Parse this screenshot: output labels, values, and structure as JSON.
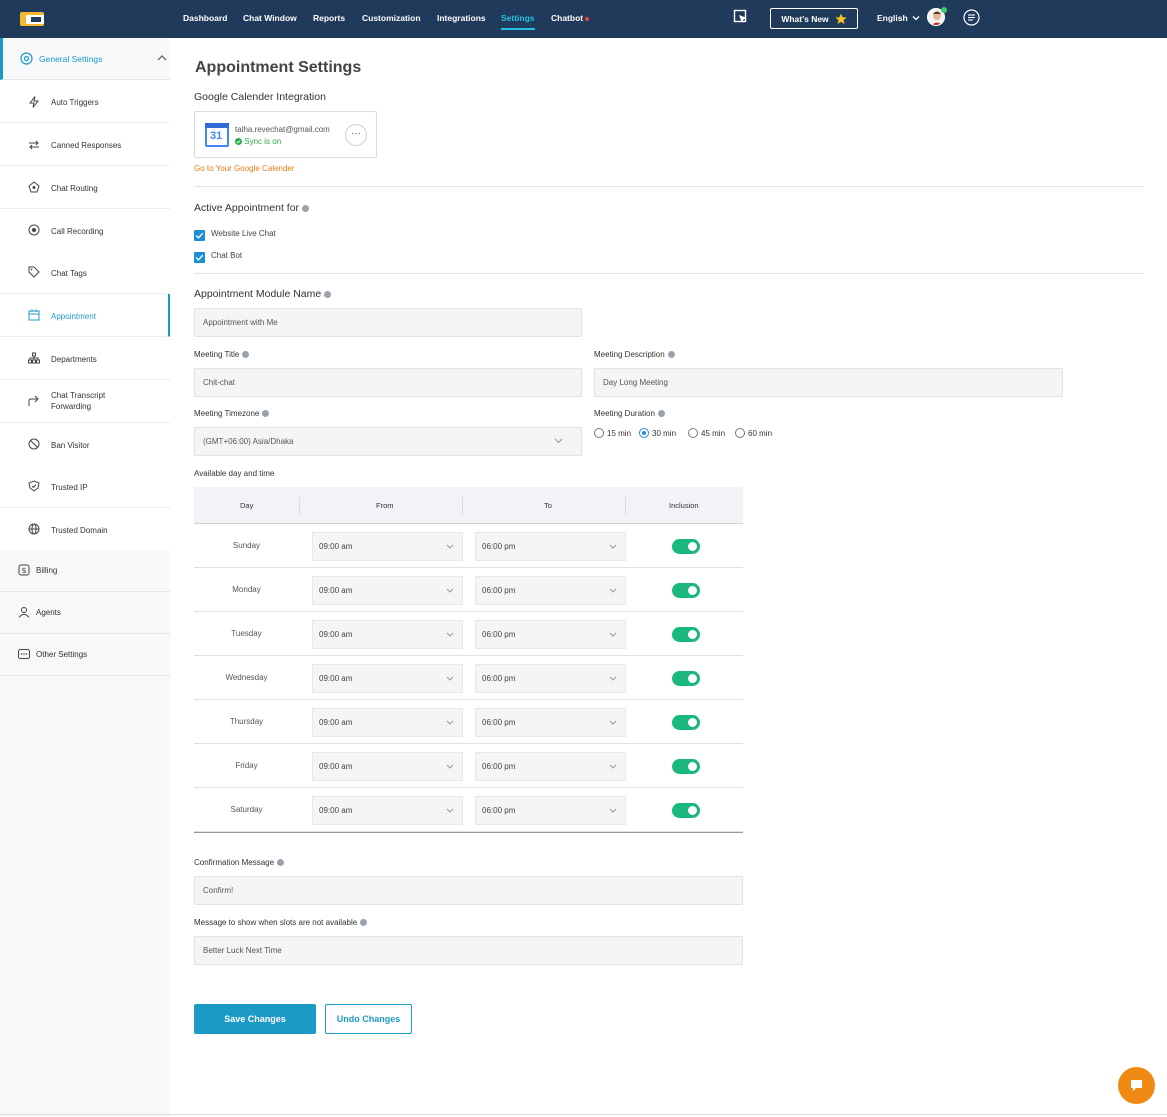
{
  "nav": {
    "items": [
      "Dashboard",
      "Chat Window",
      "Reports",
      "Customization",
      "Integrations",
      "Settings",
      "Chatbot"
    ],
    "active": "Settings",
    "whats_new": "What's New",
    "language": "English"
  },
  "sidebar": {
    "general": "General Settings",
    "sub_items": [
      "Auto Triggers",
      "Canned Responses",
      "Chat Routing",
      "Call Recording",
      "Chat Tags",
      "Appointment",
      "Departments",
      "Chat Transcript Forwarding",
      "Ban Visitor",
      "Trusted IP",
      "Trusted Domain"
    ],
    "active_item": "Appointment",
    "top_items": [
      "Billing",
      "Agents",
      "Other Settings"
    ]
  },
  "page": {
    "title": "Appointment Settings",
    "google_section": "Google Calender Integration",
    "google_email": "talha.revechat@gmail.com",
    "google_status": "Sync is on",
    "google_day": "31",
    "google_dots": "···",
    "google_link": "Go to Your Google Calender",
    "active_for": "Active Appointment for",
    "check_1": "Website Live Chat",
    "check_2": "Chat Bot",
    "module_name_label": "Appointment Module Name",
    "module_name_value": "Appointment with Me",
    "meeting_title_label": "Meeting Title",
    "meeting_title_value": "Chit-chat",
    "meeting_desc_label": "Meeting Description",
    "meeting_desc_value": "Day Long Meeting",
    "timezone_label": "Meeting Timezone",
    "timezone_value": "(GMT+06:00) Asia/Dhaka",
    "duration_label": "Meeting Duration",
    "durations": [
      "15 min",
      "30 min",
      "45 min",
      "60 min"
    ],
    "selected_duration": "30 min",
    "available_label": "Available day and time",
    "table_headers": [
      "Day",
      "From",
      "To",
      "Inclusion"
    ],
    "days": [
      {
        "day": "Sunday",
        "from": "09:00 am",
        "to": "06:00 pm",
        "included": true
      },
      {
        "day": "Monday",
        "from": "09:00 am",
        "to": "06:00 pm",
        "included": true
      },
      {
        "day": "Tuesday",
        "from": "09:00 am",
        "to": "06:00 pm",
        "included": true
      },
      {
        "day": "Wednesday",
        "from": "09:00 am",
        "to": "06:00 pm",
        "included": true
      },
      {
        "day": "Thursday",
        "from": "09:00 am",
        "to": "06:00 pm",
        "included": true
      },
      {
        "day": "Friday",
        "from": "09:00 am",
        "to": "06:00 pm",
        "included": true
      },
      {
        "day": "Saturday",
        "from": "09:00 am",
        "to": "06:00 pm",
        "included": true
      }
    ],
    "confirm_label": "Confirmation Message",
    "confirm_value": "Confirm!",
    "unavailable_label": "Message to show when slots are not available",
    "unavailable_value": "Better Luck Next Time",
    "save": "Save Changes",
    "undo": "Undo Changes"
  },
  "colors": {
    "topbar": "#1f3a5a",
    "accent": "#1c9ac6",
    "toggle_on": "#1bb87d",
    "link": "#e87817",
    "fab": "#f08a14"
  }
}
